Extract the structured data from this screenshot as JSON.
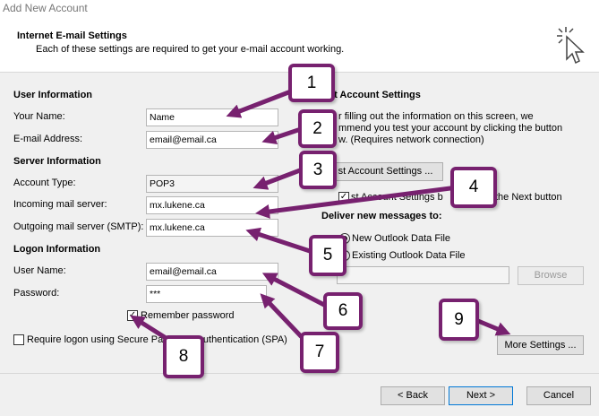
{
  "window": {
    "title": "Add New Account"
  },
  "header": {
    "title": "Internet E-mail Settings",
    "subtitle": "Each of these settings are required to get your e-mail account working."
  },
  "user_info": {
    "heading": "User Information",
    "name_label": "Your Name:",
    "name_value": "Name",
    "email_label": "E-mail Address:",
    "email_value": "email@email.ca"
  },
  "server_info": {
    "heading": "Server Information",
    "account_type_label": "Account Type:",
    "account_type_value": "POP3",
    "incoming_label": "Incoming mail server:",
    "incoming_value": "mx.lukene.ca",
    "outgoing_label": "Outgoing mail server (SMTP):",
    "outgoing_value": "mx.lukene.ca"
  },
  "logon_info": {
    "heading": "Logon Information",
    "user_label": "User Name:",
    "user_value": "email@email.ca",
    "password_label": "Password:",
    "password_value": "***",
    "remember_label": "Remember password",
    "spa_label": "Require logon using Secure Password Authentication (SPA)"
  },
  "test_settings": {
    "heading": "st Account Settings",
    "desc_line1": "r filling out the information on this screen, we",
    "desc_line2": "mmend you test your account by clicking the button",
    "desc_line3": "w. (Requires network connection)",
    "test_button": "st Account Settings ...",
    "auto_test_part1": "st Account Settings b",
    "auto_test_part2": "the Next button"
  },
  "deliver": {
    "heading": "Deliver new messages to:",
    "new_file": "New Outlook Data File",
    "existing_file": "Existing Outlook Data File",
    "browse_button": "Browse"
  },
  "more_settings_button": "More Settings ...",
  "footer": {
    "back_button": "< Back",
    "next_button": "Next >",
    "cancel_button": "Cancel"
  },
  "annotations": [
    "1",
    "2",
    "3",
    "4",
    "5",
    "6",
    "7",
    "8",
    "9"
  ],
  "colors": {
    "annotation_border": "#77216f",
    "primary_border": "#0078d7"
  },
  "icons": {
    "header": "cursor-sparkle-icon"
  }
}
